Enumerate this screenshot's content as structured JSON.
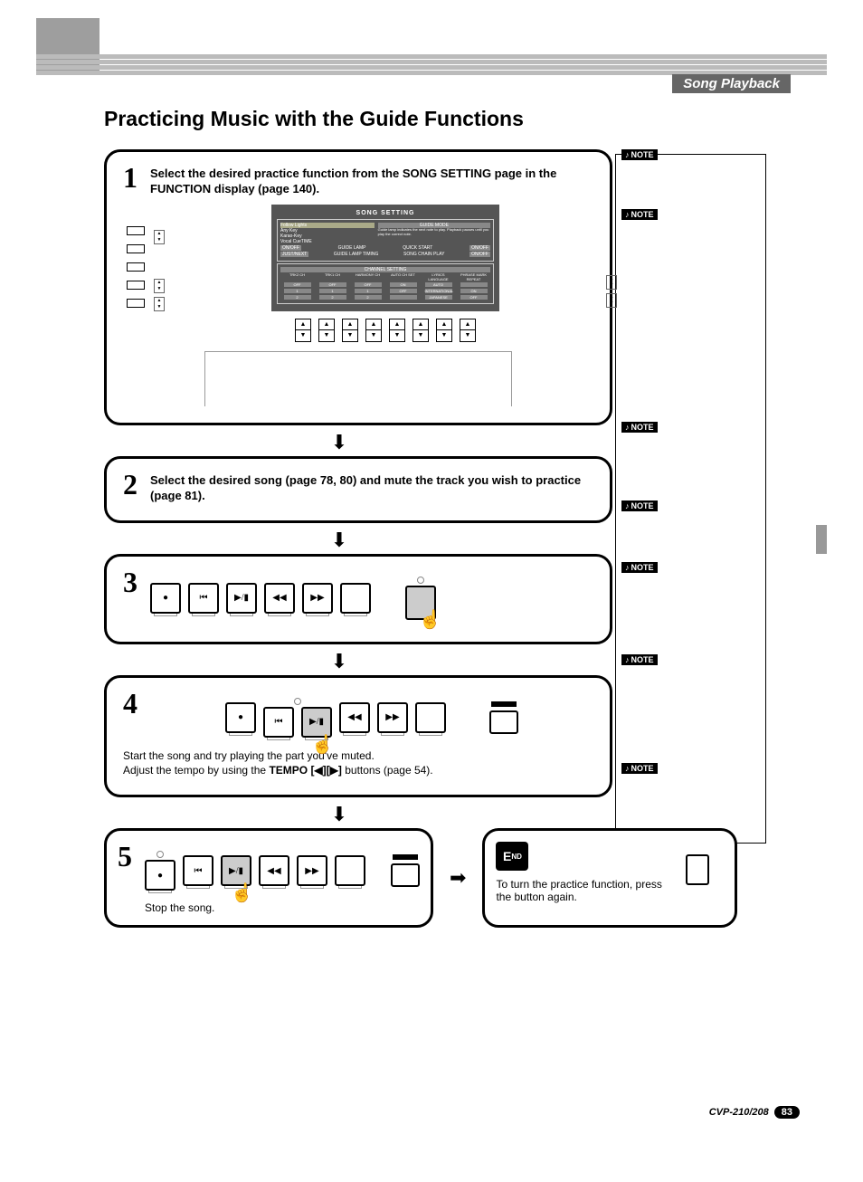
{
  "header": {
    "chapter": "Song Playback"
  },
  "title": "Practicing Music with the Guide Functions",
  "steps": {
    "s1": {
      "num": "1",
      "text": "Select the desired practice function from the SONG SETTING page in the FUNCTION display (page 140)."
    },
    "s2": {
      "num": "2",
      "text": "Select the desired song (page 78, 80) and mute the track you wish to practice (page 81)."
    },
    "s3": {
      "num": "3"
    },
    "s4": {
      "num": "4",
      "text1": "Start the song and try playing the part you've muted.",
      "text2a": "Adjust the tempo by using the ",
      "text2b": "TEMPO [◀][▶]",
      "text2c": " buttons (page 54)."
    },
    "s5": {
      "num": "5",
      "text": "Stop the song."
    },
    "end": {
      "label": "END",
      "text": "To turn the practice function, press the button again."
    }
  },
  "lcd": {
    "title": "SONG SETTING",
    "guide_mode_label": "GUIDE MODE",
    "guide_desc": "Guide lamp indicates the next note to play. Playback pauses until you play the correct note.",
    "options": [
      "Follow Lights",
      "Any Key",
      "Karao-Key",
      "Vocal CueTIME"
    ],
    "guide_lamp": "GUIDE LAMP",
    "quick_start": "QUICK START",
    "guide_lamp_timing": "GUIDE LAMP TIMING",
    "song_chain": "SONG CHAIN PLAY",
    "on": "ON",
    "off": "OFF",
    "just": "JUST",
    "next": "NEXT",
    "channel_setting": "CHANNEL SETTING",
    "channels": {
      "headers": [
        "TRK2 CH",
        "TRK1 CH",
        "HARMONY CH",
        "AUTO CH SET",
        "LYRICS LANGUAGE",
        "PHRASE MARK REPEAT"
      ],
      "r1": [
        "OFF",
        "OFF",
        "OFF",
        "ON",
        "AUTO",
        ""
      ],
      "r2": [
        "1",
        "1",
        "1",
        "OFF",
        "INTERNATIONAL",
        "ON"
      ],
      "r3": [
        "2",
        "2",
        "2",
        "",
        "JAPANESE",
        "OFF"
      ]
    }
  },
  "notes": {
    "label": "NOTE"
  },
  "footer": {
    "model": "CVP-210/208",
    "page": "83"
  }
}
